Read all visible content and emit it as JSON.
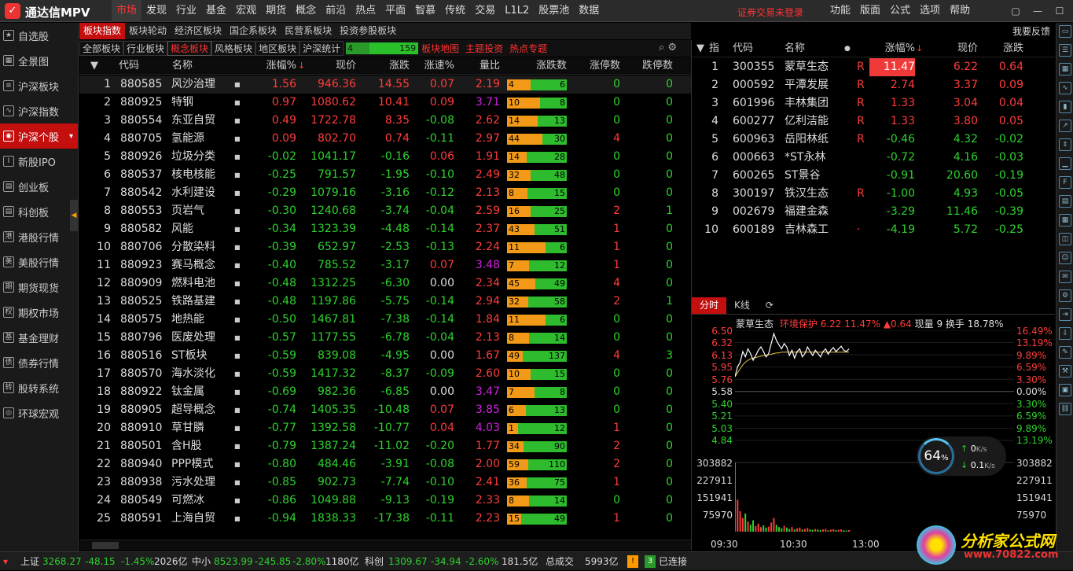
{
  "app": {
    "logo_glyph": "✓",
    "title": "通达信MPV"
  },
  "menu": [
    "市场",
    "发现",
    "行业",
    "基金",
    "宏观",
    "期货",
    "概念",
    "前沿",
    "热点",
    "平面",
    "智慕",
    "传统",
    "交易",
    "L1L2",
    "股票池",
    "数据"
  ],
  "menu_active": "市场",
  "login_text": "证券交易未登录",
  "right_menu": [
    "功能",
    "版面",
    "公式",
    "选项",
    "帮助"
  ],
  "window_buttons": [
    "▢",
    "—",
    "☐",
    "✕"
  ],
  "sidebar": [
    {
      "label": "自选股",
      "icon": "star-icon"
    },
    {
      "label": "全景图",
      "icon": "panorama-icon"
    },
    {
      "label": "沪深板块",
      "icon": "sector-icon"
    },
    {
      "label": "沪深指数",
      "icon": "index-icon"
    },
    {
      "label": "沪深个股",
      "icon": "stock-icon",
      "active": true
    },
    {
      "label": "新股IPO",
      "icon": "ipo-icon"
    },
    {
      "label": "创业板",
      "icon": "board-icon"
    },
    {
      "label": "科创板",
      "icon": "board-icon"
    },
    {
      "label": "港股行情",
      "icon": "hk-icon"
    },
    {
      "label": "美股行情",
      "icon": "us-icon"
    },
    {
      "label": "期货现货",
      "icon": "futures-icon"
    },
    {
      "label": "期权市场",
      "icon": "options-icon"
    },
    {
      "label": "基金理财",
      "icon": "fund-icon"
    },
    {
      "label": "债券行情",
      "icon": "bond-icon"
    },
    {
      "label": "股转系统",
      "icon": "transfer-icon"
    },
    {
      "label": "环球宏观",
      "icon": "globe-icon"
    }
  ],
  "tabs1": [
    "板块指数",
    "板块轮动",
    "经济区板块",
    "国企系板块",
    "民营系板块",
    "投资参股板块"
  ],
  "tabs1_active": 0,
  "feedback": "我要反馈",
  "tabs2": [
    "全部板块",
    "行业板块",
    "概念板块",
    "风格板块",
    "地区板块",
    "沪深统计"
  ],
  "tabs2_active": 2,
  "sh_count": {
    "up": "4",
    "down": "159"
  },
  "tabs2_links": [
    "板块地图",
    "主题投资",
    "热点专题"
  ],
  "columns": [
    "代码",
    "名称",
    "涨幅%",
    "现价",
    "涨跌",
    "涨速%",
    "量比",
    "涨跌数",
    "涨停数",
    "跌停数"
  ],
  "rows": [
    [
      "1",
      "880585",
      "风沙治理",
      "1.56",
      "946.36",
      "14.55",
      "0.07",
      "2.19",
      "4",
      "6",
      "0",
      "0"
    ],
    [
      "2",
      "880925",
      "特钢",
      "0.97",
      "1080.62",
      "10.41",
      "0.09",
      "3.71",
      "10",
      "8",
      "0",
      "0"
    ],
    [
      "3",
      "880554",
      "东亚自贸",
      "0.49",
      "1722.78",
      "8.35",
      "-0.08",
      "2.62",
      "14",
      "13",
      "0",
      "0"
    ],
    [
      "4",
      "880705",
      "氢能源",
      "0.09",
      "802.70",
      "0.74",
      "-0.11",
      "2.97",
      "44",
      "30",
      "4",
      "0"
    ],
    [
      "5",
      "880926",
      "垃圾分类",
      "-0.02",
      "1041.17",
      "-0.16",
      "0.06",
      "1.91",
      "14",
      "28",
      "0",
      "0"
    ],
    [
      "6",
      "880537",
      "核电核能",
      "-0.25",
      "791.57",
      "-1.95",
      "-0.10",
      "2.49",
      "32",
      "48",
      "0",
      "0"
    ],
    [
      "7",
      "880542",
      "水利建设",
      "-0.29",
      "1079.16",
      "-3.16",
      "-0.12",
      "2.13",
      "8",
      "15",
      "0",
      "0"
    ],
    [
      "8",
      "880553",
      "页岩气",
      "-0.30",
      "1240.68",
      "-3.74",
      "-0.04",
      "2.59",
      "16",
      "25",
      "2",
      "1"
    ],
    [
      "9",
      "880582",
      "风能",
      "-0.34",
      "1323.39",
      "-4.48",
      "-0.14",
      "2.37",
      "43",
      "51",
      "1",
      "0"
    ],
    [
      "10",
      "880706",
      "分散染料",
      "-0.39",
      "652.97",
      "-2.53",
      "-0.13",
      "2.24",
      "11",
      "6",
      "1",
      "0"
    ],
    [
      "11",
      "880923",
      "赛马概念",
      "-0.40",
      "785.52",
      "-3.17",
      "0.07",
      "3.48",
      "7",
      "12",
      "1",
      "0"
    ],
    [
      "12",
      "880909",
      "燃料电池",
      "-0.48",
      "1312.25",
      "-6.30",
      "0.00",
      "2.34",
      "45",
      "49",
      "4",
      "0"
    ],
    [
      "13",
      "880525",
      "铁路基建",
      "-0.48",
      "1197.86",
      "-5.75",
      "-0.14",
      "2.94",
      "32",
      "58",
      "2",
      "1"
    ],
    [
      "14",
      "880575",
      "地热能",
      "-0.50",
      "1467.81",
      "-7.38",
      "-0.14",
      "1.84",
      "11",
      "6",
      "0",
      "0"
    ],
    [
      "15",
      "880796",
      "医废处理",
      "-0.57",
      "1177.55",
      "-6.78",
      "-0.04",
      "2.13",
      "8",
      "14",
      "0",
      "0"
    ],
    [
      "16",
      "880516",
      "ST板块",
      "-0.59",
      "839.08",
      "-4.95",
      "0.00",
      "1.67",
      "49",
      "137",
      "4",
      "3"
    ],
    [
      "17",
      "880570",
      "海水淡化",
      "-0.59",
      "1417.32",
      "-8.37",
      "-0.09",
      "2.60",
      "10",
      "15",
      "0",
      "0"
    ],
    [
      "18",
      "880922",
      "钛金属",
      "-0.69",
      "982.36",
      "-6.85",
      "0.00",
      "3.47",
      "7",
      "8",
      "0",
      "0"
    ],
    [
      "19",
      "880905",
      "超导概念",
      "-0.74",
      "1405.35",
      "-10.48",
      "0.07",
      "3.85",
      "6",
      "13",
      "0",
      "0"
    ],
    [
      "20",
      "880910",
      "草甘膦",
      "-0.77",
      "1392.58",
      "-10.77",
      "0.04",
      "4.03",
      "1",
      "12",
      "1",
      "0"
    ],
    [
      "21",
      "880501",
      "含H股",
      "-0.79",
      "1387.24",
      "-11.02",
      "-0.20",
      "1.77",
      "34",
      "90",
      "2",
      "0"
    ],
    [
      "22",
      "880940",
      "PPP模式",
      "-0.80",
      "484.46",
      "-3.91",
      "-0.08",
      "2.00",
      "59",
      "110",
      "2",
      "0"
    ],
    [
      "23",
      "880938",
      "污水处理",
      "-0.85",
      "902.73",
      "-7.74",
      "-0.10",
      "2.41",
      "36",
      "75",
      "1",
      "0"
    ],
    [
      "24",
      "880549",
      "可燃冰",
      "-0.86",
      "1049.88",
      "-9.13",
      "-0.19",
      "2.33",
      "8",
      "14",
      "0",
      "0"
    ],
    [
      "25",
      "880591",
      "上海自贸",
      "-0.94",
      "1838.33",
      "-17.38",
      "-0.11",
      "2.23",
      "15",
      "49",
      "1",
      "0"
    ]
  ],
  "right_columns": [
    "指",
    "代码",
    "名称",
    "涨幅%",
    "现价",
    "涨跌"
  ],
  "right_rows": [
    [
      "1",
      "300355",
      "蒙草生态",
      "R",
      "11.47",
      "6.22",
      "0.64"
    ],
    [
      "2",
      "000592",
      "平潭发展",
      "R",
      "2.74",
      "3.37",
      "0.09"
    ],
    [
      "3",
      "601996",
      "丰林集团",
      "R",
      "1.33",
      "3.04",
      "0.04"
    ],
    [
      "4",
      "600277",
      "亿利洁能",
      "R",
      "1.33",
      "3.80",
      "0.05"
    ],
    [
      "5",
      "600963",
      "岳阳林纸",
      "R",
      "-0.46",
      "4.32",
      "-0.02"
    ],
    [
      "6",
      "000663",
      "*ST永林",
      "",
      "-0.72",
      "4.16",
      "-0.03"
    ],
    [
      "7",
      "600265",
      "ST景谷",
      "",
      "-0.91",
      "20.60",
      "-0.19"
    ],
    [
      "8",
      "300197",
      "铁汉生态",
      "R",
      "-1.00",
      "4.93",
      "-0.05"
    ],
    [
      "9",
      "002679",
      "福建金森",
      "",
      "-3.29",
      "11.46",
      "-0.39"
    ],
    [
      "10",
      "600189",
      "吉林森工",
      "·",
      "-4.19",
      "5.72",
      "-0.25"
    ]
  ],
  "mini_tabs": [
    "分时",
    "K线",
    "⟳"
  ],
  "chart_header": {
    "name": "蒙草生态",
    "sector": "环境保护",
    "price": "6.22",
    "pct": "11.47%",
    "chg": "▲0.64",
    "vol_label": "现量",
    "vol": "9",
    "turn_label": "换手",
    "turn": "18.78%"
  },
  "chart_data": {
    "type": "line",
    "price_axis_left": [
      "6.50",
      "6.32",
      "6.13",
      "5.95",
      "5.76",
      "5.58",
      "5.40",
      "5.21",
      "5.03",
      "4.84"
    ],
    "price_axis_right": [
      "16.49%",
      "13.19%",
      "9.89%",
      "6.59%",
      "3.30%",
      "0.00%",
      "3.30%",
      "6.59%",
      "9.89%",
      "13.19%"
    ],
    "volume_axis_left": [
      "303882",
      "227911",
      "151941",
      "75970"
    ],
    "volume_axis_right": [
      "303882",
      "227911",
      "151941",
      "75970"
    ],
    "x_ticks": [
      "09:30",
      "10:30",
      "13:00"
    ],
    "prev_close": 5.58,
    "ylim": [
      4.84,
      6.5
    ],
    "price": [
      5.8,
      5.95,
      6.02,
      6.18,
      6.1,
      6.22,
      6.15,
      6.05,
      6.12,
      6.2,
      6.25,
      6.18,
      6.1,
      6.15,
      6.3,
      6.45,
      6.35,
      6.28,
      6.22,
      6.3,
      6.25,
      6.12,
      6.2,
      6.08,
      6.18,
      6.22,
      6.1,
      6.15,
      6.25,
      6.18,
      6.12,
      6.2,
      6.15,
      6.1,
      6.18,
      6.22,
      6.14,
      6.2,
      6.24,
      6.18,
      6.22,
      6.26,
      6.2,
      6.18,
      6.22
    ],
    "avg": [
      5.8,
      5.86,
      5.92,
      5.98,
      6.02,
      6.05,
      6.07,
      6.08,
      6.09,
      6.1,
      6.11,
      6.12,
      6.12,
      6.13,
      6.14,
      6.15,
      6.16,
      6.16,
      6.17,
      6.17,
      6.17,
      6.17,
      6.17,
      6.17,
      6.17,
      6.17,
      6.17,
      6.17,
      6.17,
      6.17,
      6.17,
      6.17,
      6.17,
      6.17,
      6.17,
      6.17,
      6.17,
      6.17,
      6.17,
      6.17,
      6.17,
      6.17,
      6.17,
      6.17,
      6.17
    ],
    "vol_max": 303882,
    "volume": [
      303882,
      140000,
      90000,
      60000,
      80000,
      45000,
      30000,
      50000,
      25000,
      35000,
      20000,
      28000,
      18000,
      22000,
      40000,
      60000,
      30000,
      20000,
      15000,
      25000,
      18000,
      12000,
      20000,
      10000,
      15000,
      18000,
      9000,
      12000,
      16000,
      10000,
      8000,
      12000,
      9000,
      7000,
      10000,
      12000,
      6000,
      9000,
      11000,
      7000,
      8000,
      10000,
      6000,
      5000,
      7000
    ]
  },
  "perf": {
    "pct": "64",
    "unit": "%",
    "up": "0",
    "up_unit": "K/s",
    "down": "0.1",
    "down_unit": "K/s"
  },
  "right_side_icons": [
    "split-icon",
    "list-icon",
    "table-icon",
    "chart-icon",
    "kline-icon",
    "trend-icon",
    "candle-icon",
    "bar-icon",
    "f10-icon",
    "doc-icon",
    "grid-icon",
    "layers-icon",
    "user-icon",
    "news-icon",
    "settings-icon",
    "export-icon",
    "download-icon",
    "pen-icon",
    "tools-icon",
    "calendar-icon",
    "link-icon"
  ],
  "status": {
    "sh_label": "上证",
    "sh_val": "3268.27",
    "sh_chg": "-48.15",
    "sh_pct": "-1.45%",
    "sh_amt": "2026亿",
    "zx_label": "中小",
    "zx_val": "8523.99",
    "zx_chg": "-245.85",
    "zx_pct": "-2.80%",
    "zx_amt": "1180亿",
    "kc_label": "科创",
    "kc_val": "1309.67",
    "kc_chg": "-34.94",
    "kc_pct": "-2.60%",
    "kc_amt": "181.5亿",
    "total_label": "总成交",
    "total_amt": "5993亿",
    "conn_num": "3",
    "conn": "已连接"
  },
  "watermark": {
    "text": "分析家公式网",
    "url": "www.70822.com"
  }
}
